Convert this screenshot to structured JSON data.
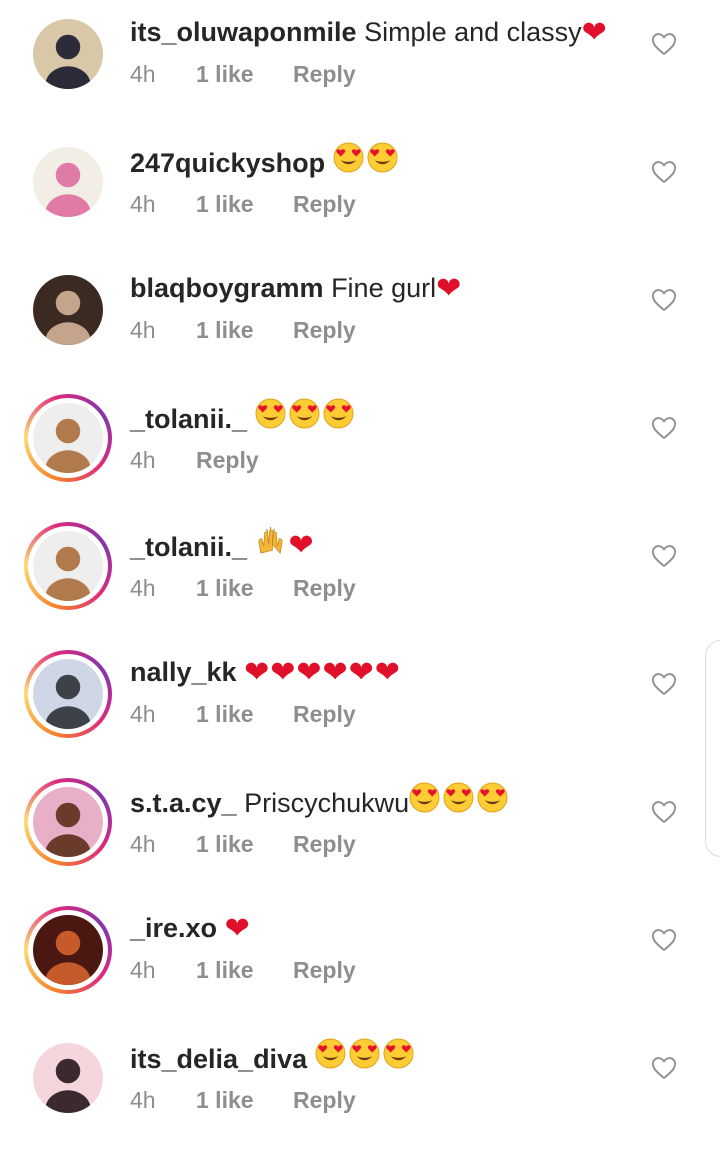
{
  "comments": [
    {
      "username": "its_oluwaponmile",
      "text": "Simple and classy",
      "emoji": "heart",
      "emoji_count": 1,
      "time": "4h",
      "likes": "1 like",
      "reply": "Reply",
      "avatar_style": "plain",
      "avatar_colors": [
        "#d9c8a8",
        "#2b2b3a"
      ]
    },
    {
      "username": "247quickyshop",
      "text": "",
      "emoji": "heart-eyes",
      "emoji_count": 2,
      "time": "4h",
      "likes": "1 like",
      "reply": "Reply",
      "avatar_style": "plain",
      "avatar_colors": [
        "#f2eee6",
        "#e07aa6"
      ]
    },
    {
      "username": "blaqboygramm",
      "text": "Fine gurl",
      "emoji": "heart",
      "emoji_count": 1,
      "time": "4h",
      "likes": "1 like",
      "reply": "Reply",
      "avatar_style": "plain",
      "avatar_colors": [
        "#3a2a22",
        "#c4a48a"
      ]
    },
    {
      "username": "_tolanii._",
      "text": "",
      "emoji": "heart-eyes",
      "emoji_count": 3,
      "time": "4h",
      "likes": "",
      "reply": "Reply",
      "avatar_style": "ring",
      "avatar_colors": [
        "#eeeeee",
        "#b07a4c"
      ]
    },
    {
      "username": "_tolanii._",
      "text": "",
      "emoji": "raised-hands-heart",
      "emoji_count": 1,
      "time": "4h",
      "likes": "1 like",
      "reply": "Reply",
      "avatar_style": "ring",
      "avatar_colors": [
        "#eeeeee",
        "#b07a4c"
      ]
    },
    {
      "username": "nally_kk",
      "text": "",
      "emoji": "heart",
      "emoji_count": 6,
      "time": "4h",
      "likes": "1 like",
      "reply": "Reply",
      "avatar_style": "ring",
      "avatar_colors": [
        "#cfd6e6",
        "#3d4148"
      ]
    },
    {
      "username": "s.t.a.cy_",
      "text": "Priscychukwu",
      "emoji": "heart-eyes",
      "emoji_count": 3,
      "time": "4h",
      "likes": "1 like",
      "reply": "Reply",
      "avatar_style": "ring",
      "avatar_colors": [
        "#e8b0c8",
        "#6a3a2a"
      ]
    },
    {
      "username": "_ire.xo",
      "text": "",
      "emoji": "heart",
      "emoji_count": 1,
      "time": "4h",
      "likes": "1 like",
      "reply": "Reply",
      "avatar_style": "ring",
      "avatar_colors": [
        "#4a1810",
        "#c65a2a"
      ]
    },
    {
      "username": "its_delia_diva",
      "text": "",
      "emoji": "heart-eyes",
      "emoji_count": 3,
      "time": "4h",
      "likes": "1 like",
      "reply": "Reply",
      "avatar_style": "plain",
      "avatar_colors": [
        "#f5d6dc",
        "#3a2a30"
      ]
    }
  ],
  "colors": {
    "heart": "#e0102a",
    "meta": "#8e8e8e",
    "username": "#262626"
  },
  "icons": {
    "like": "heart-outline-icon"
  }
}
